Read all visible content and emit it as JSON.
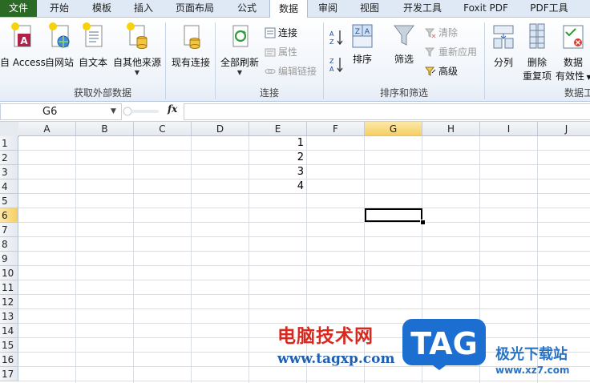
{
  "tabs": [
    "文件",
    "开始",
    "模板",
    "插入",
    "页面布局",
    "公式",
    "数据",
    "审阅",
    "视图",
    "开发工具",
    "Foxit PDF",
    "PDF工具"
  ],
  "active_tab": "数据",
  "ribbon": {
    "get_external": {
      "group_label": "获取外部数据",
      "access": "自 Access",
      "web": "自网站",
      "text": "自文本",
      "other": "自其他来源",
      "existing": "现有连接"
    },
    "connections": {
      "group_label": "连接",
      "refresh_all": "全部刷新",
      "connections": "连接",
      "properties": "属性",
      "edit_links": "编辑链接"
    },
    "sort_filter": {
      "group_label": "排序和筛选",
      "sort": "排序",
      "filter": "筛选",
      "clear": "清除",
      "reapply": "重新应用",
      "advanced": "高级"
    },
    "data_tools": {
      "group_label": "数据工",
      "text_to_columns": "分列",
      "remove_dup_1": "删除",
      "remove_dup_2": "重复项",
      "validation_1": "数据",
      "validation_2": "有效性"
    }
  },
  "formula_bar": {
    "name_box": "G6",
    "fx": "fx",
    "content": ""
  },
  "sheet": {
    "columns": [
      "A",
      "B",
      "C",
      "D",
      "E",
      "F",
      "G",
      "H",
      "I",
      "J"
    ],
    "rows": [
      "1",
      "2",
      "3",
      "4",
      "5",
      "6",
      "7",
      "8",
      "9",
      "10",
      "11",
      "12",
      "13",
      "14",
      "15",
      "16",
      "17"
    ],
    "selected_cell": "G6",
    "cells": [
      {
        "ref": "E1",
        "value": "1"
      },
      {
        "ref": "E2",
        "value": "2"
      },
      {
        "ref": "E3",
        "value": "3"
      },
      {
        "ref": "E4",
        "value": "4"
      }
    ]
  },
  "watermark": {
    "site_cn": "电脑技术网",
    "site_url": "www.tagxp.com",
    "badge": "TAG",
    "site2_cn": "极光下载站",
    "site2_url": "www.xz7.com"
  },
  "colors": {
    "file_tab": "#2a6a25",
    "selected_header": "#f6cf63",
    "badge_blue": "#1c6fd0"
  }
}
